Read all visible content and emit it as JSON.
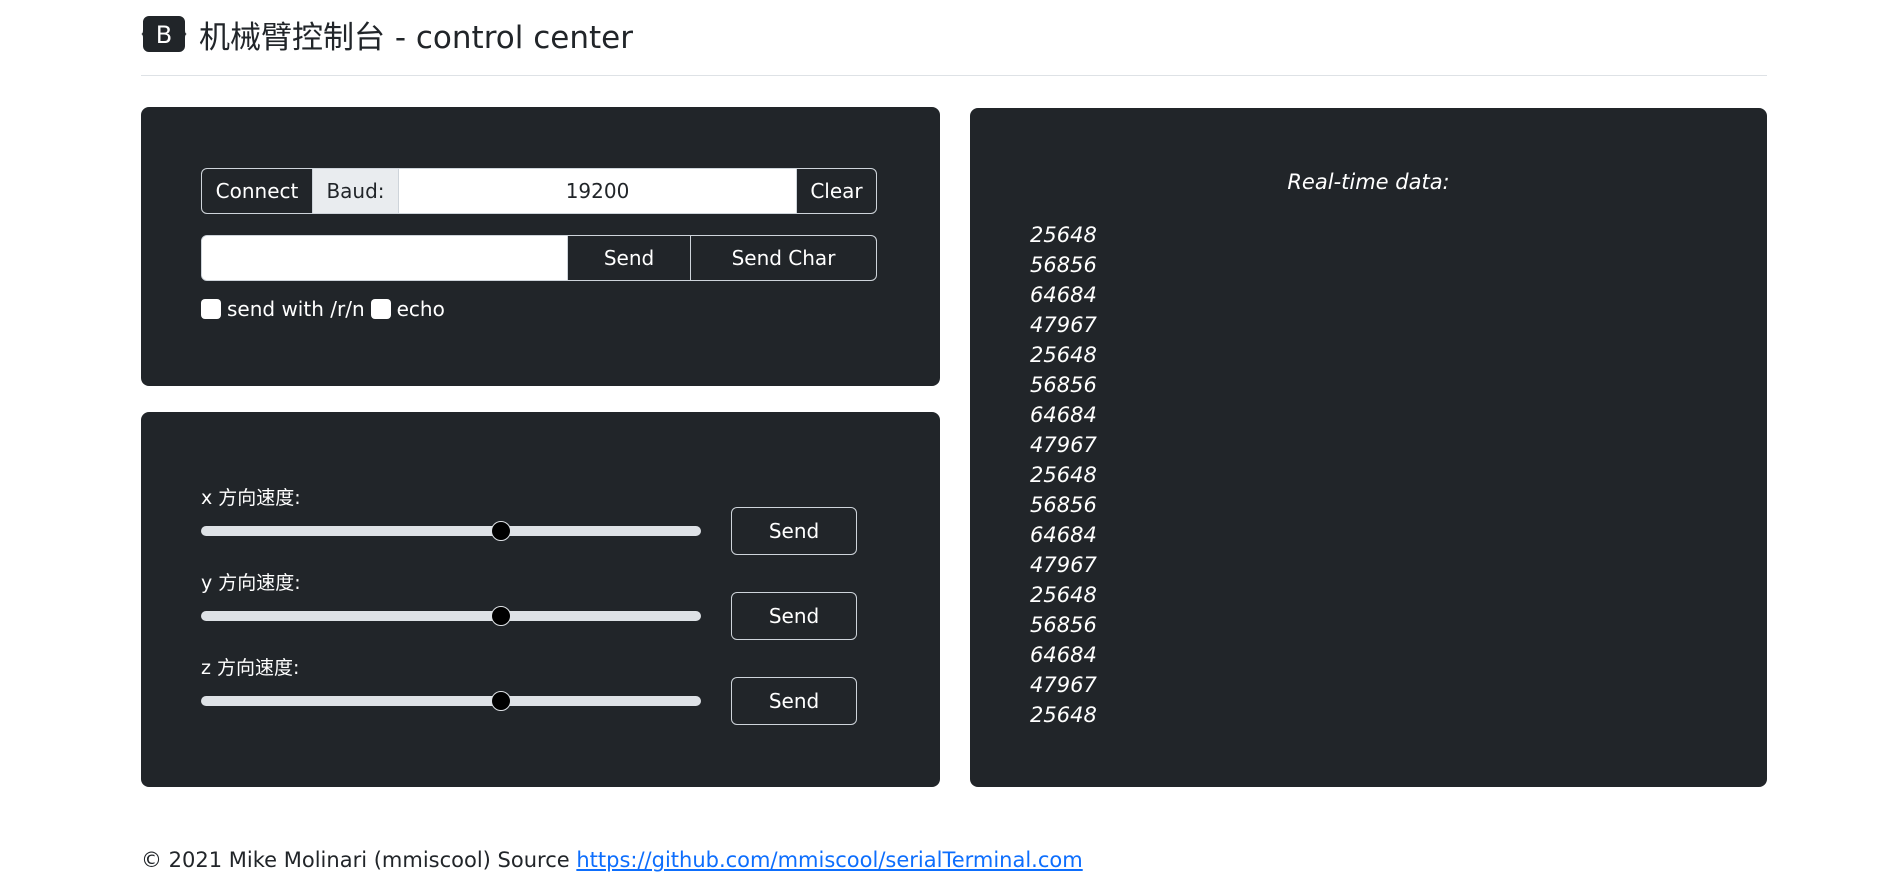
{
  "header": {
    "logo_letter": "B",
    "title": "机械臂控制台 - control center"
  },
  "serial": {
    "connect_label": "Connect",
    "baud_label": "Baud:",
    "baud_value": "19200",
    "clear_label": "Clear",
    "send_input_value": "",
    "send_label": "Send",
    "send_char_label": "Send Char",
    "checkbox_crlf_label": "send with /r/n",
    "checkbox_crlf_checked": false,
    "checkbox_echo_label": "echo",
    "checkbox_echo_checked": false
  },
  "speed": {
    "items": [
      {
        "label": "x 方向速度:",
        "value_fraction": 0.6,
        "send_label": "Send"
      },
      {
        "label": "y 方向速度:",
        "value_fraction": 0.6,
        "send_label": "Send"
      },
      {
        "label": "z 方向速度:",
        "value_fraction": 0.6,
        "send_label": "Send"
      }
    ]
  },
  "data_panel": {
    "title": "Real-time data:",
    "lines": [
      "25648",
      "56856",
      "64684",
      "47967",
      "25648",
      "56856",
      "64684",
      "47967",
      "25648",
      "56856",
      "64684",
      "47967",
      "25648",
      "56856",
      "64684",
      "47967",
      "25648"
    ]
  },
  "footer": {
    "text": "© 2021 Mike Molinari (mmiscool) Source ",
    "link_text": "https://github.com/mmiscool/serialTerminal.com"
  },
  "colors": {
    "panel_bg": "#212529",
    "link": "#0d6efd"
  }
}
